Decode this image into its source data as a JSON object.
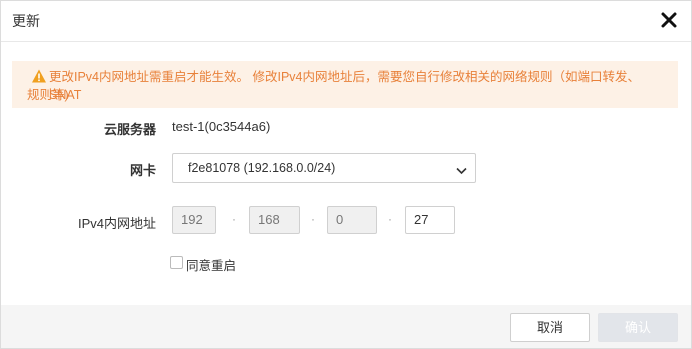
{
  "dialog": {
    "title": "更新",
    "close_icon": "close-icon"
  },
  "alert": {
    "icon": "warning-icon",
    "color": "#e8813a",
    "background": "#fdf1e6",
    "line1": "更改IPv4内网地址需重启才能生效。 修改IPv4内网地址后，需要您自行修改相关的网络规则（如端口转发、SNAT",
    "line2": "规则等)"
  },
  "form": {
    "server": {
      "label": "云服务器",
      "value": "test-1(0c3544a6)"
    },
    "nic": {
      "label": "网卡",
      "selected": "f2e81078 (192.168.0.0/24)"
    },
    "ip": {
      "label": "IPv4内网地址",
      "octets": [
        "192",
        "168",
        "0",
        "27"
      ],
      "separator": "·"
    },
    "agree": {
      "label": "同意重启",
      "checked": false
    }
  },
  "footer": {
    "cancel_label": "取消",
    "confirm_label": "确认",
    "confirm_disabled": true
  }
}
